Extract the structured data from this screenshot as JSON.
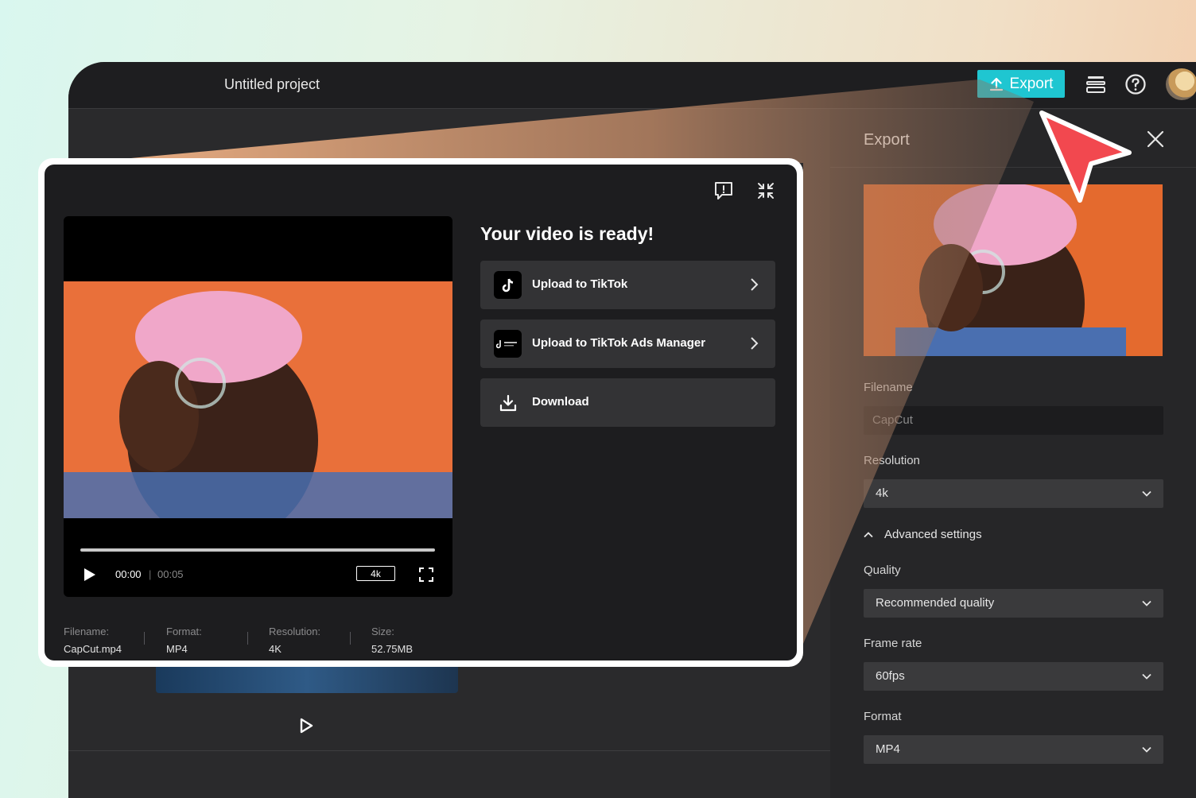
{
  "app": {
    "project_title": "Untitled project",
    "export_label": "Export"
  },
  "panel": {
    "title": "Export",
    "filename_label": "Filename",
    "filename_value": "CapCut",
    "resolution_label": "Resolution",
    "resolution_value": "4k",
    "advanced_label": "Advanced settings",
    "quality_label": "Quality",
    "quality_value": "Recommended quality",
    "framerate_label": "Frame rate",
    "framerate_value": "60fps",
    "format_label": "Format",
    "format_value": "MP4"
  },
  "modal": {
    "ready_title": "Your video is ready!",
    "actions": [
      {
        "label": "Upload to TikTok"
      },
      {
        "label": "Upload to TikTok Ads Manager"
      },
      {
        "label": "Download"
      }
    ],
    "player": {
      "current_time": "00:00",
      "duration": "00:05",
      "quality": "4k"
    },
    "meta": [
      {
        "label": "Filename:",
        "value": "CapCut.mp4"
      },
      {
        "label": "Format:",
        "value": "MP4"
      },
      {
        "label": "Resolution:",
        "value": "4K"
      },
      {
        "label": "Size:",
        "value": "52.75MB"
      }
    ]
  },
  "colors": {
    "accent": "#1fc6d1",
    "pointer": "#f2484f",
    "video_bg": "#e9703a"
  },
  "icons": [
    "upload-icon",
    "layers-icon",
    "help-icon",
    "close-icon",
    "feedback-icon",
    "collapse-icon",
    "tiktok-icon",
    "tiktok-business-icon",
    "download-icon",
    "chevron-right-icon",
    "chevron-down-icon",
    "chevron-up-icon",
    "play-icon",
    "fullscreen-icon"
  ]
}
